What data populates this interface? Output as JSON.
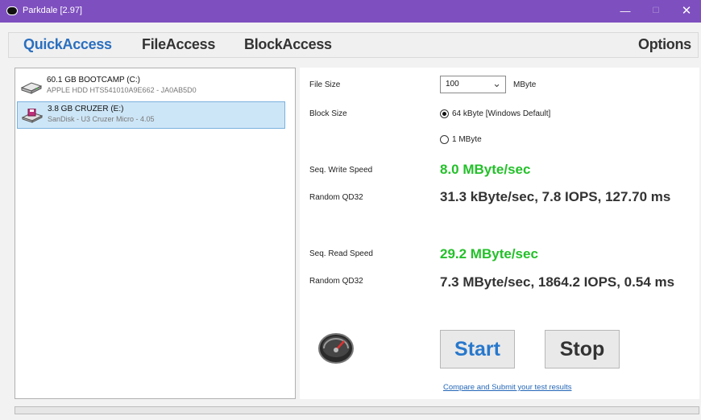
{
  "window": {
    "title": "Parkdale [2.97]",
    "minimize": "—",
    "maximize": "☐",
    "close": "✕"
  },
  "menu": {
    "items": [
      "QuickAccess",
      "FileAccess",
      "BlockAccess"
    ],
    "options": "Options"
  },
  "drives": [
    {
      "name": "60.1 GB BOOTCAMP (C:)",
      "detail": "APPLE HDD HTS541010A9E662 - JA0AB5D0",
      "icon": "hard-drive-icon",
      "selected": false
    },
    {
      "name": "3.8 GB CRUZER (E:)",
      "detail": "SanDisk - U3 Cruzer Micro - 4.05",
      "icon": "usb-drive-icon",
      "selected": true
    }
  ],
  "settings": {
    "file_size_label": "File Size",
    "file_size_value": "100",
    "file_size_unit": "MByte",
    "block_size_label": "Block Size",
    "block_options": [
      "64 kByte [Windows Default]",
      "1 MByte"
    ],
    "block_selected": "64 kByte [Windows Default]"
  },
  "results": {
    "seq_write_label": "Seq. Write Speed",
    "seq_write_value": "8.0 MByte/sec",
    "random_write_label": "Random QD32",
    "random_write_value": "31.3 kByte/sec, 7.8 IOPS, 127.70 ms",
    "seq_read_label": "Seq. Read Speed",
    "seq_read_value": "29.2 MByte/sec",
    "random_read_label": "Random QD32",
    "random_read_value": "7.3 MByte/sec, 1864.2 IOPS, 0.54 ms"
  },
  "actions": {
    "start": "Start",
    "stop": "Stop",
    "compare_link": "Compare and Submit your test results"
  },
  "progress": {
    "fraction": 0
  },
  "colors": {
    "titlebar": "#7e4fbf",
    "active_tab": "#2a6fbf",
    "speed_green": "#24c02a",
    "selection": "#cde6f7"
  }
}
